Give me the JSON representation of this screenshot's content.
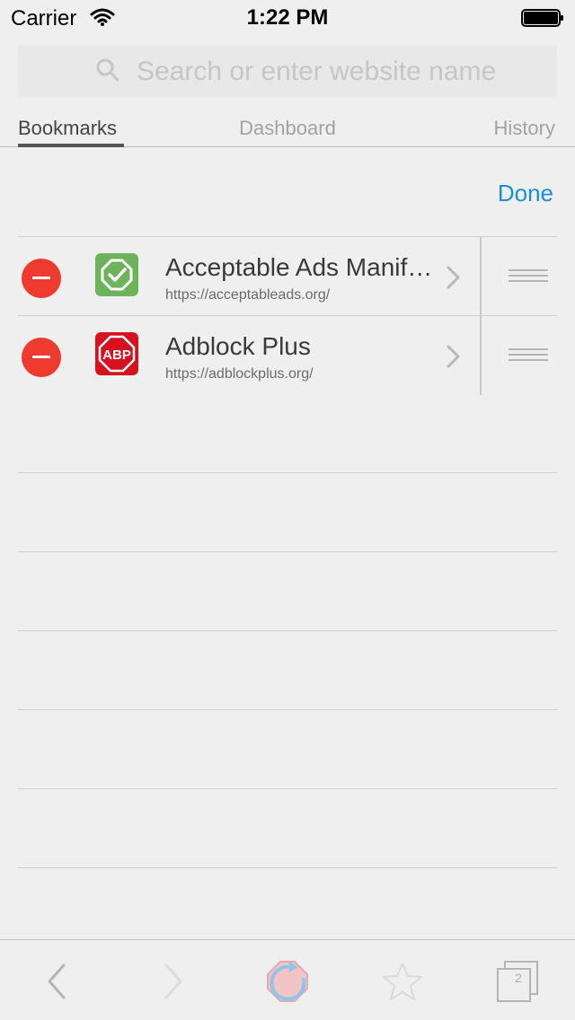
{
  "status_bar": {
    "carrier": "Carrier",
    "time": "1:22 PM"
  },
  "search": {
    "placeholder": "Search or enter website name"
  },
  "tabs": [
    {
      "label": "Bookmarks",
      "active": true
    },
    {
      "label": "Dashboard",
      "active": false
    },
    {
      "label": "History",
      "active": false
    }
  ],
  "actions": {
    "done_label": "Done"
  },
  "bookmarks": [
    {
      "title": "Acceptable Ads Manifesto",
      "url": "https://acceptableads.org/",
      "icon": "acceptable-ads-icon"
    },
    {
      "title": "Adblock Plus",
      "url": "https://adblockplus.org/",
      "icon": "abp-icon",
      "icon_text": "ABP"
    }
  ],
  "toolbar": {
    "open_tabs_count": "2"
  },
  "colors": {
    "accent": "#1a8fd4",
    "delete": "#ef3a2f",
    "acceptable_ads_green": "#6db35a",
    "abp_red": "#d8111f"
  }
}
